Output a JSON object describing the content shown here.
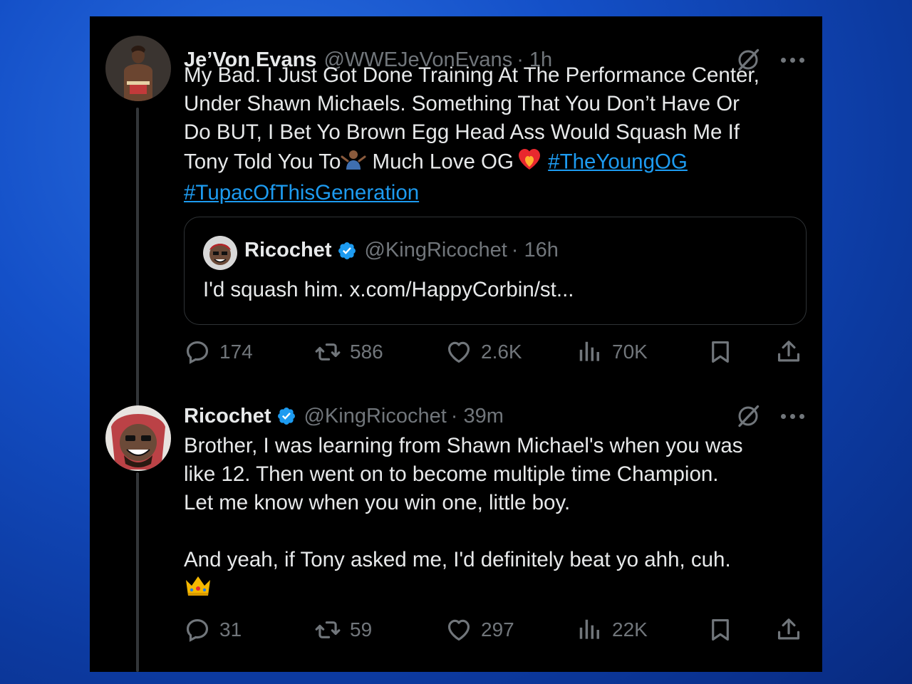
{
  "tweets": [
    {
      "name": "Je’Von Evans",
      "handle": "@WWEJeVonEvans",
      "time": "· 1h",
      "verified": false,
      "text_plain": "My Bad. I Just Got Done Training At The Performance Center,\nUnder Shawn Michaels. Something That You Don’t Have Or\nDo BUT, I Bet Yo Brown Egg Head Ass Would Squash Me If\nTony Told You To",
      "text_mid": " Much Love OG",
      "hashtag1": "#TheYoungOG",
      "hashtag2": "#TupacOfThisGeneration",
      "emojis": [
        "shrug-emoji",
        "heart-on-fire-emoji"
      ],
      "quote": {
        "name": "Ricochet",
        "handle": "@KingRicochet",
        "time": "· 16h",
        "text": "I'd squash him. x.com/HappyCorbin/st..."
      },
      "stats": {
        "replies": "174",
        "reposts": "586",
        "likes": "2.6K",
        "views": "70K"
      }
    },
    {
      "name": "Ricochet",
      "handle": "@KingRicochet",
      "time": "· 39m",
      "verified": true,
      "text": "Brother, I was learning from Shawn Michael's when you was\nlike 12. Then went on to become multiple time Champion.\nLet me know when you win one, little boy.\n\nAnd yeah, if Tony asked me, I'd definitely beat yo ahh, cuh.",
      "emojis": [
        "crown-emoji"
      ],
      "stats": {
        "replies": "31",
        "reposts": "59",
        "likes": "297",
        "views": "22K"
      }
    }
  ],
  "colors": {
    "background": "#000000",
    "text": "#e7e9ea",
    "muted": "#71767b",
    "link": "#1d9bf0",
    "verified": "#1d9bf0",
    "border": "#2f3336",
    "outer_background": "#1450c8"
  },
  "icons": [
    "grok-icon",
    "more-icon",
    "reply-icon",
    "repost-icon",
    "like-icon",
    "views-icon",
    "bookmark-icon",
    "share-icon",
    "verified-badge-icon"
  ]
}
